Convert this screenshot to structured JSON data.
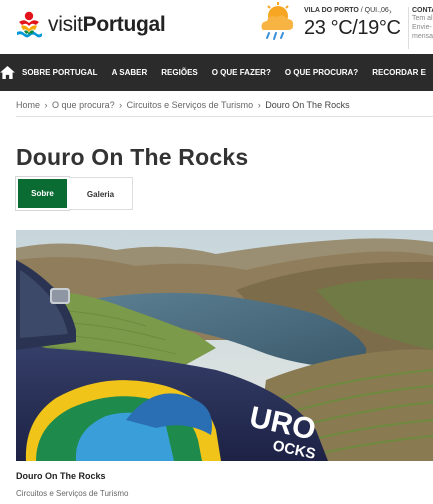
{
  "header": {
    "logo_prefix": "visit",
    "logo_brand": "Portugal",
    "weather": {
      "place": "VILA DO PORTO",
      "date": "/ QUI.,06",
      "temperature": "23 °C/19°C",
      "icon": "rain-cloud-sun-icon"
    },
    "contact": {
      "title": "CONTA",
      "line1": "Tem al",
      "line2": "Envie-",
      "line3": "mensa"
    }
  },
  "nav": {
    "items": [
      {
        "label": "SOBRE PORTUGAL"
      },
      {
        "label": "A SABER"
      },
      {
        "label": "REGIÕES"
      },
      {
        "label": "O QUE FAZER?"
      },
      {
        "label": "O QUE PROCURA?"
      },
      {
        "label": "RECORDAR E"
      }
    ]
  },
  "breadcrumb": {
    "home": "Home",
    "level1": "O que procura?",
    "level2": "Circuitos e Serviços de Turismo",
    "current": "Douro On The Rocks",
    "separator": "›"
  },
  "page": {
    "title": "Douro On The Rocks",
    "tabs": [
      {
        "label": "Sobre",
        "active": true
      },
      {
        "label": "Galeria",
        "active": false
      }
    ]
  },
  "card": {
    "title": "Douro On The Rocks",
    "subtitle": "Circuitos e Serviços de Turismo",
    "vehicle_text_1": "URO",
    "vehicle_text_2": "OCKS"
  },
  "colors": {
    "brand_green": "#0a6b33",
    "nav_bg": "#2b2b2b",
    "weather_sun": "#f6a623"
  }
}
